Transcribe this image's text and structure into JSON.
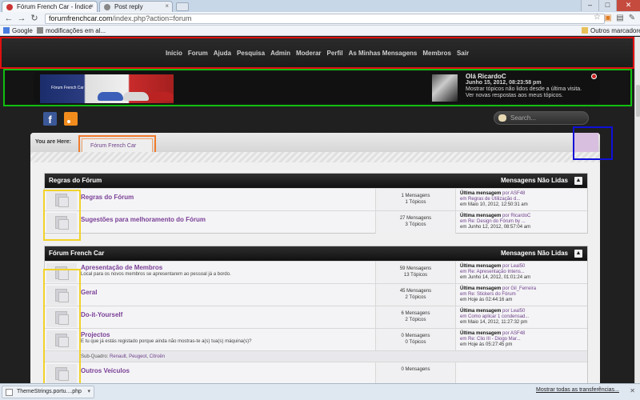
{
  "browser": {
    "tabs": [
      {
        "title": "Fórum French Car - Índice",
        "active": true
      },
      {
        "title": "Post reply",
        "active": false
      }
    ],
    "url_host": "forumfrenchcar.com",
    "url_path": "/index.php?action=forum",
    "bookmarks": [
      {
        "label": "Google",
        "icon": "google-icon"
      },
      {
        "label": "modificações em al...",
        "icon": "bookmark-page-icon"
      }
    ],
    "other_bookmarks": "Outros marcadores",
    "downloads": {
      "file": "ThemeStrings.portu....php",
      "show_all": "Mostrar todas as transferências..."
    }
  },
  "nav": {
    "items": [
      "Início",
      "Forum",
      "Ajuda",
      "Pesquisa",
      "Admin",
      "Moderar",
      "Perfil",
      "As Minhas Mensagens",
      "Membros",
      "Sair"
    ]
  },
  "banner": {
    "logo_text": "Fórum French Car",
    "greeting": "Olá RicardoC",
    "date": "Junho 15, 2012, 08:23:58 pm",
    "line1": "Mostrar tópicos não lidos desde a última visita.",
    "line2": "Ver novas respostas aos meus tópicos."
  },
  "search": {
    "placeholder": "Search..."
  },
  "breadcrumb": {
    "label": "You are Here:",
    "current": "Fórum French Car"
  },
  "categories": [
    {
      "title": "Regras do Fórum",
      "unread_label": "Mensagens Não Lidas",
      "boards": [
        {
          "name": "Regras do Fórum",
          "desc": "",
          "posts": "1 Mensagens",
          "topics": "1 Tópicos",
          "last_label": "Última mensagem",
          "by": "por ASF48",
          "in": "em Regras de Utilização d...",
          "when": "em Maio 10, 2012, 12:50:31 am"
        },
        {
          "name": "Sugestões para melhoramento do Fórum",
          "desc": "",
          "posts": "27 Mensagens",
          "topics": "3 Tópicos",
          "last_label": "Última mensagem",
          "by": "por RicardoC",
          "in": "em Re: Design do Fórum by ...",
          "when": "em Junho 12, 2012, 08:57:04 am"
        }
      ]
    },
    {
      "title": "Fórum French Car",
      "unread_label": "Mensagens Não Lidas",
      "boards": [
        {
          "name": "Apresentação de Membros",
          "desc": "Local para os novos membros se apresentarem ao pessoal já a bordo.",
          "posts": "59 Mensagens",
          "topics": "13 Tópicos",
          "last_label": "Última mensagem",
          "by": "por Leal50",
          "in": "em Re: Apresentação Intens...",
          "when": "em Junho 14, 2012, 01:01:24 am"
        },
        {
          "name": "Geral",
          "desc": "",
          "posts": "45 Mensagens",
          "topics": "2 Tópicos",
          "last_label": "Última mensagem",
          "by": "por Gil_Ferreira",
          "in": "em Re: Stickers do Fórum",
          "when": "em Hoje às 02:44:16 am"
        },
        {
          "name": "Do-it-Yourself",
          "desc": "",
          "posts": "6 Mensagens",
          "topics": "2 Tópicos",
          "last_label": "Última mensagem",
          "by": "por Leal50",
          "in": "em Como aplicar 1 condensad...",
          "when": "em Maio 14, 2012, 11:27:32 pm"
        },
        {
          "name": "Projectos",
          "desc": "E tu que já estás registado porque ainda não mostras-te a(s) tua(s) máquina(s)?",
          "posts": "0 Mensagens",
          "topics": "0 Tópicos",
          "last_label": "Última mensagem",
          "by": "por ASF48",
          "in": "em Re: Clio III - Diogo Mar...",
          "when": "em Hoje às 05:27:45 pm"
        },
        {
          "name": "Outros Veículos",
          "desc": "",
          "posts": "0 Mensagens",
          "topics": "",
          "last_label": "",
          "by": "",
          "in": "",
          "when": ""
        }
      ],
      "subboards_label": "Sub-Quadro:",
      "subboards": [
        "Renault",
        "Peugeot",
        "Citroën"
      ]
    }
  ],
  "colors": {
    "accent": "#7a3f96",
    "nav_bg": "#1c1c1c",
    "annot_red": "#e01010",
    "annot_green": "#10c010",
    "annot_blue": "#1010d8",
    "annot_yellow": "#f2d22a",
    "annot_orange": "#f07a2a"
  }
}
